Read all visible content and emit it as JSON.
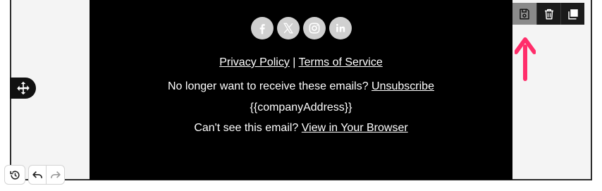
{
  "footer": {
    "social_icons": [
      "facebook-icon",
      "x-icon",
      "instagram-icon",
      "linkedin-icon"
    ],
    "privacy_label": "Privacy Policy",
    "separator": " | ",
    "terms_label": "Terms of Service",
    "unsubscribe_prefix": "No longer want to receive these emails? ",
    "unsubscribe_label": "Unsubscribe",
    "company_address": "{{companyAddress}}",
    "browser_prefix": "Can't see this email? ",
    "browser_label": "View in Your Browser"
  },
  "toolbar": {
    "icons": [
      "save-icon",
      "trash-icon",
      "duplicate-icon"
    ]
  },
  "colors": {
    "footer_bg": "#000000",
    "canvas_bg": "#f4f4f4",
    "social_bg": "#d0d0d0",
    "arrow": "#ff2d6a",
    "toolbar_bg": "#1b1b1b",
    "save_active_bg": "#8a8a8a"
  }
}
